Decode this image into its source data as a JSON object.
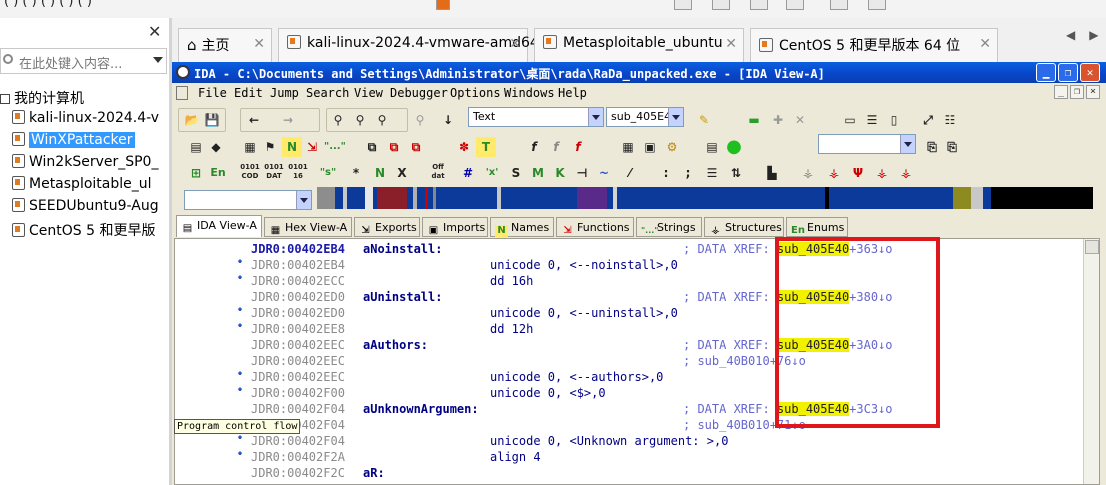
{
  "library": {
    "search_placeholder": "在此处键入内容...",
    "root": "我的计算机",
    "items": [
      {
        "label": "kali-linux-2024.4-v",
        "selected": false
      },
      {
        "label": "WinXPattacker",
        "selected": true
      },
      {
        "label": "Win2kServer_SP0_",
        "selected": false
      },
      {
        "label": "Metasploitable_ul",
        "selected": false
      },
      {
        "label": "SEEDUbuntu9-Aug",
        "selected": false
      },
      {
        "label": "CentOS 5 和更早版",
        "selected": false
      }
    ]
  },
  "vm_tabs": [
    {
      "label": "主页",
      "icon": "home-icon"
    },
    {
      "label": "kali-linux-2024.4-vmware-amd64",
      "icon": "vm-icon"
    },
    {
      "label": "Metasploitable_ubuntu",
      "icon": "vm-icon"
    },
    {
      "label": "CentOS 5 和更早版本 64 位",
      "icon": "vm-icon"
    }
  ],
  "ida": {
    "title": "IDA - C:\\Documents and Settings\\Administrator\\桌面\\rada\\RaDa_unpacked.exe - [IDA View-A]",
    "menu": [
      "File",
      "Edit",
      "Jump",
      "Search",
      "View",
      "Debugger",
      "Options",
      "Windows",
      "Help"
    ],
    "combo_text": "Text",
    "combo_func": "sub_405E4",
    "subtabs": [
      "IDA View-A",
      "Hex View-A",
      "Exports",
      "Imports",
      "Names",
      "Functions",
      "Strings",
      "Structures",
      "Enums"
    ],
    "listing": [
      {
        "bullet": false,
        "addr": "JDR0:00402EB4",
        "label_line": true,
        "name": "aNoinstall:",
        "instr": "",
        "cmt": "; DATA XREF: ",
        "xref": "sub_405E40",
        "xnum": "+363↓o"
      },
      {
        "bullet": true,
        "addr": "JDR0:00402EB4",
        "label_line": false,
        "name": "",
        "instr": "unicode 0, <--noinstall>,0",
        "cmt": "",
        "xref": "",
        "xnum": ""
      },
      {
        "bullet": true,
        "addr": "JDR0:00402ECC",
        "label_line": false,
        "name": "",
        "instr": "dd 16h",
        "cmt": "",
        "xref": "",
        "xnum": ""
      },
      {
        "bullet": false,
        "addr": "JDR0:00402ED0",
        "label_line": false,
        "name": "aUninstall:",
        "instr": "",
        "cmt": "; DATA XREF: ",
        "xref": "sub_405E40",
        "xnum": "+380↓o"
      },
      {
        "bullet": true,
        "addr": "JDR0:00402ED0",
        "label_line": false,
        "name": "",
        "instr": "unicode 0, <--uninstall>,0",
        "cmt": "",
        "xref": "",
        "xnum": ""
      },
      {
        "bullet": true,
        "addr": "JDR0:00402EE8",
        "label_line": false,
        "name": "",
        "instr": "dd 12h",
        "cmt": "",
        "xref": "",
        "xnum": ""
      },
      {
        "bullet": false,
        "addr": "JDR0:00402EEC",
        "label_line": false,
        "name": "aAuthors:",
        "instr": "",
        "cmt": "; DATA XREF: ",
        "xref": "sub_405E40",
        "xnum": "+3A0↓o"
      },
      {
        "bullet": false,
        "addr": "JDR0:00402EEC",
        "label_line": false,
        "name": "",
        "instr": "",
        "cmt": "; sub_40B010+76↓o",
        "xref": "",
        "xnum": ""
      },
      {
        "bullet": true,
        "addr": "JDR0:00402EEC",
        "label_line": false,
        "name": "",
        "instr": "unicode 0, <--authors>,0",
        "cmt": "",
        "xref": "",
        "xnum": ""
      },
      {
        "bullet": true,
        "addr": "JDR0:00402F00",
        "label_line": false,
        "name": "",
        "instr": "unicode 0, <$>,0",
        "cmt": "",
        "xref": "",
        "xnum": ""
      },
      {
        "bullet": false,
        "addr": "JDR0:00402F04",
        "label_line": false,
        "name": "aUnknownArgumen:",
        "instr": "",
        "cmt": "; DATA XREF: ",
        "xref": "sub_405E40",
        "xnum": "+3C3↓o"
      },
      {
        "bullet": false,
        "addr": "JDR0:00402F04",
        "label_line": false,
        "name": "",
        "instr": "",
        "cmt": "; sub_40B010+71↓o",
        "xref": "",
        "xnum": ""
      },
      {
        "bullet": true,
        "addr": "JDR0:00402F04",
        "label_line": false,
        "name": "",
        "instr": "unicode 0, <Unknown argument: >,0",
        "cmt": "",
        "xref": "",
        "xnum": ""
      },
      {
        "bullet": true,
        "addr": "JDR0:00402F2A",
        "label_line": false,
        "name": "",
        "instr": "align 4",
        "cmt": "",
        "xref": "",
        "xnum": ""
      },
      {
        "bullet": false,
        "addr": "JDR0:00402F2C",
        "label_line": false,
        "name": "aR:",
        "instr": "",
        "cmt": "",
        "xref": "",
        "xnum": ""
      }
    ],
    "tooltip": "Program control flow"
  },
  "colors": {
    "title_blue": "#0845c8",
    "xref_highlight": "#f2f200",
    "annotation_red": "#e0171a",
    "selection": "#3399ff"
  }
}
